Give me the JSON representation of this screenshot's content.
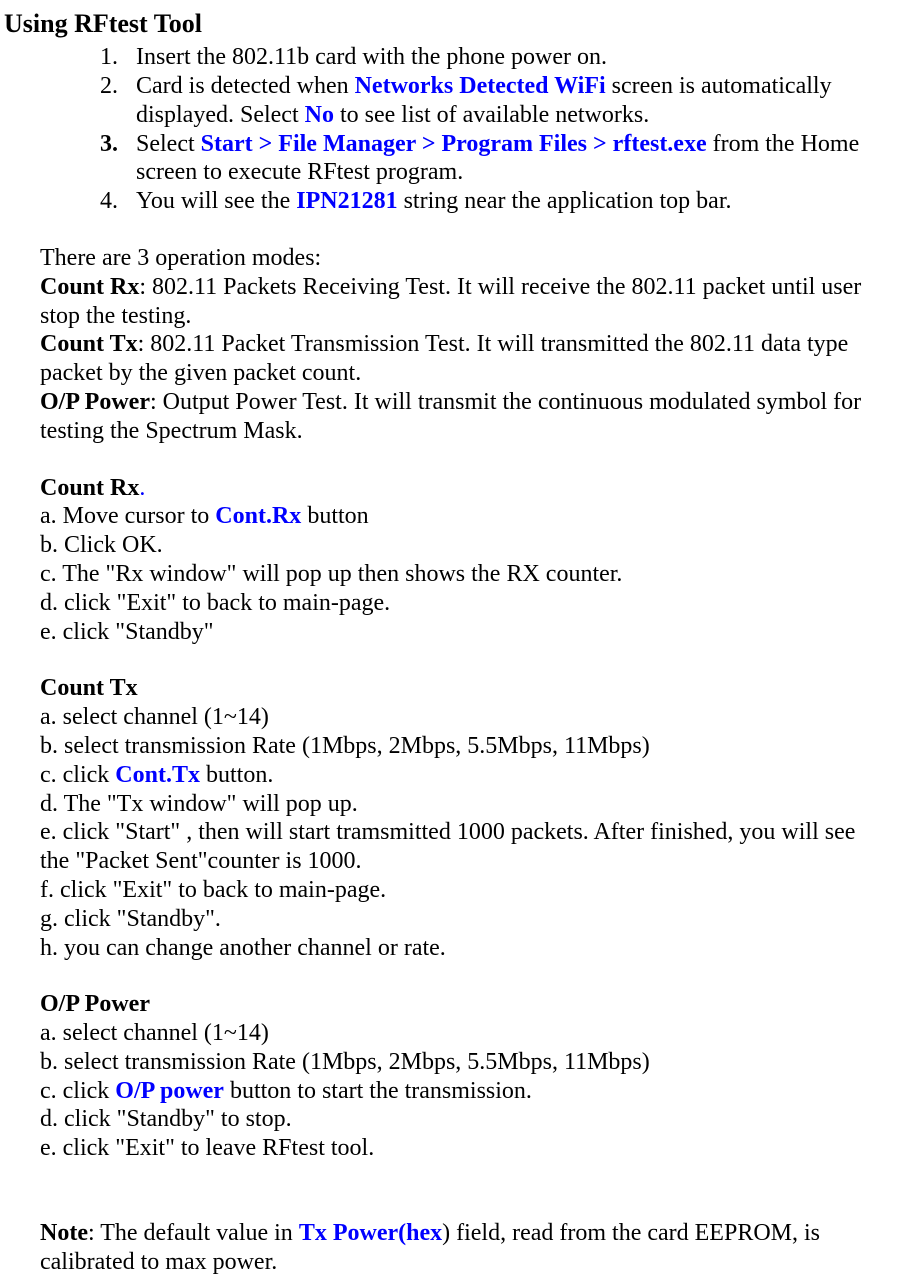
{
  "title": "Using RFtest Tool",
  "numbered": {
    "item1_num": "1.",
    "item1_text": "Insert the 802.11b card with the phone power on.",
    "item2_num": "2.",
    "item2_pre": "Card is detected when ",
    "item2_blue": "Networks Detected WiFi",
    "item2_mid": " screen is automatically displayed. Select ",
    "item2_blue2": "No",
    "item2_post": " to see list of available networks.",
    "item3_num": "3.",
    "item3_pre": "Select ",
    "item3_blue": "Start > File Manager > Program Files > rftest.exe",
    "item3_post": " from the Home screen to execute RFtest program.",
    "item4_num": "4.",
    "item4_pre": "You will see the ",
    "item4_blue": "IPN21281",
    "item4_post": " string near the application top bar."
  },
  "modes_intro": "There are 3 operation modes:",
  "mode1_label": "Count Rx",
  "mode1_text": ":  802.11 Packets Receiving Test. It will receive the 802.11 packet until user stop the testing.",
  "mode2_label": "Count Tx",
  "mode2_text": ":   802.11 Packet Transmission Test. It will transmitted the 802.11 data type packet by the given packet count.",
  "mode3_label": "O/P Power",
  "mode3_text": ":  Output Power Test. It will transmit the continuous modulated symbol for testing the Spectrum Mask.",
  "countrx_header": "Count Rx",
  "countrx_dot": ".",
  "countrx_a_pre": " a. Move cursor to ",
  "countrx_a_blue": "Cont.Rx",
  "countrx_a_post": " button",
  "countrx_b": " b. Click OK.",
  "countrx_c": " c. The \"Rx window\" will pop up then shows the RX counter.",
  "countrx_d": " d. click \"Exit\" to back to main-page.",
  "countrx_e": " e. click \"Standby\"",
  "counttx_header": "Count Tx",
  "counttx_a": " a. select channel (1~14)",
  "counttx_b": " b. select transmission Rate (1Mbps, 2Mbps, 5.5Mbps, 11Mbps)",
  "counttx_c_pre": " c. click ",
  "counttx_c_blue": "Cont.Tx",
  "counttx_c_post": " button.",
  "counttx_d": " d. The \"Tx window\" will pop up.",
  "counttx_e": " e.  click \"Start\"  , then will start tramsmitted 1000 packets. After finished, you will see the \"Packet Sent\"counter is 1000.",
  "counttx_f": " f.  click \"Exit\" to back to main-page.",
  "counttx_g": " g. click \"Standby\".",
  "counttx_h": " h.  you can change another channel or rate.",
  "oppower_header": "O/P Power",
  "oppower_a": " a. select channel (1~14)",
  "oppower_b": " b. select transmission Rate (1Mbps, 2Mbps, 5.5Mbps, 11Mbps)",
  "oppower_c_pre": " c. click ",
  "oppower_c_blue": "O/P power",
  "oppower_c_post": " button to start the transmission.",
  "oppower_d": " d. click \"Standby\" to stop.",
  "oppower_e": " e. click \"Exit\"  to leave RFtest tool.",
  "note_label": "Note",
  "note_pre": ":  The default value in ",
  "note_blue": "Tx Power(hex",
  "note_post": ") field, read from the card EEPROM, is calibrated to max power."
}
